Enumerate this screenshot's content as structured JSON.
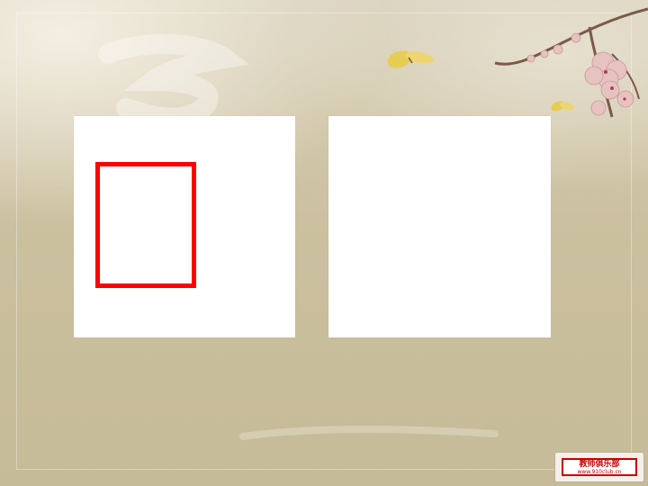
{
  "watermark": {
    "title": "教师俱乐部",
    "url": "www.910club.cn"
  },
  "colors": {
    "background": "#c6bb98",
    "panel": "#ffffff",
    "box_border": "#ff0000"
  },
  "icons": [
    "plum-blossom-icon",
    "butterfly-icon",
    "butterfly-icon"
  ]
}
